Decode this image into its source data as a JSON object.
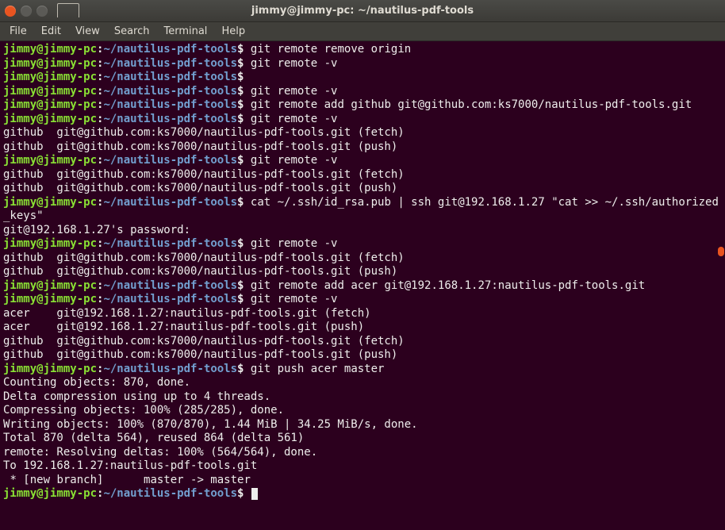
{
  "window": {
    "title": "jimmy@jimmy-pc: ~/nautilus-pdf-tools"
  },
  "menu": {
    "file": "File",
    "edit": "Edit",
    "view": "View",
    "search": "Search",
    "terminal": "Terminal",
    "help": "Help"
  },
  "prompt": {
    "user_host": "jimmy@jimmy-pc",
    "colon": ":",
    "path": "~/nautilus-pdf-tools",
    "sigil": "$"
  },
  "lines": {
    "l1_cmd": " git remote remove origin",
    "l2_cmd": " git remote -v",
    "l3_cmd": "",
    "l4_cmd": " git remote -v",
    "l5_cmd": " git remote add github git@github.com:ks7000/nautilus-pdf-tools.git",
    "l6_cmd": " git remote -v",
    "l7_out": "github  git@github.com:ks7000/nautilus-pdf-tools.git (fetch)",
    "l8_out": "github  git@github.com:ks7000/nautilus-pdf-tools.git (push)",
    "l9_cmd": " git remote -v",
    "l10_out": "github  git@github.com:ks7000/nautilus-pdf-tools.git (fetch)",
    "l11_out": "github  git@github.com:ks7000/nautilus-pdf-tools.git (push)",
    "l12_cmd": " cat ~/.ssh/id_rsa.pub | ssh git@192.168.1.27 \"cat >> ~/.ssh/authorized_keys\"",
    "l13_out": "git@192.168.1.27's password:",
    "l14_cmd": " git remote -v",
    "l15_out": "github  git@github.com:ks7000/nautilus-pdf-tools.git (fetch)",
    "l16_out": "github  git@github.com:ks7000/nautilus-pdf-tools.git (push)",
    "l17_cmd": " git remote add acer git@192.168.1.27:nautilus-pdf-tools.git",
    "l18_cmd": " git remote -v",
    "l19_out": "acer    git@192.168.1.27:nautilus-pdf-tools.git (fetch)",
    "l20_out": "acer    git@192.168.1.27:nautilus-pdf-tools.git (push)",
    "l21_out": "github  git@github.com:ks7000/nautilus-pdf-tools.git (fetch)",
    "l22_out": "github  git@github.com:ks7000/nautilus-pdf-tools.git (push)",
    "l23_cmd": " git push acer master",
    "l24_out": "Counting objects: 870, done.",
    "l25_out": "Delta compression using up to 4 threads.",
    "l26_out": "Compressing objects: 100% (285/285), done.",
    "l27_out": "Writing objects: 100% (870/870), 1.44 MiB | 34.25 MiB/s, done.",
    "l28_out": "Total 870 (delta 564), reused 864 (delta 561)",
    "l29_out": "remote: Resolving deltas: 100% (564/564), done.",
    "l30_out": "To 192.168.1.27:nautilus-pdf-tools.git",
    "l31_out": " * [new branch]      master -> master",
    "l32_cmd": " "
  }
}
